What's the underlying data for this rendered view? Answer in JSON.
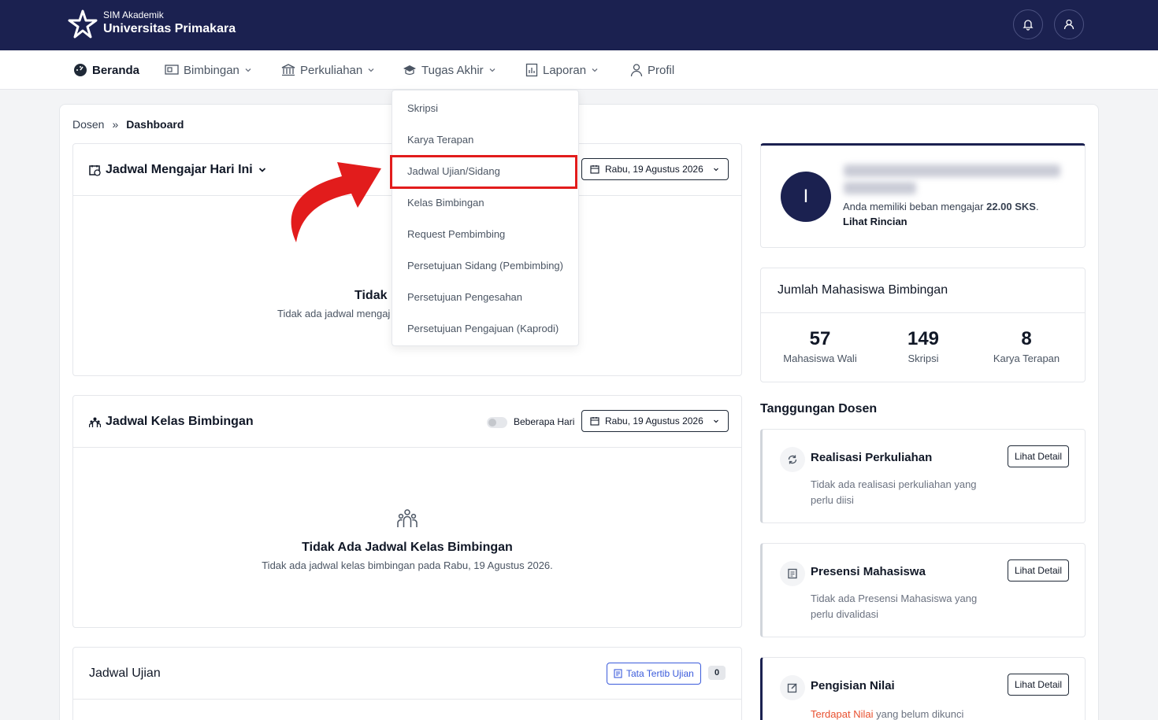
{
  "header": {
    "sub_title": "SIM Akademik",
    "title": "Universitas Primakara"
  },
  "nav": {
    "items": [
      {
        "label": "Beranda"
      },
      {
        "label": "Bimbingan"
      },
      {
        "label": "Perkuliahan"
      },
      {
        "label": "Tugas Akhir"
      },
      {
        "label": "Laporan"
      },
      {
        "label": "Profil"
      }
    ]
  },
  "tugas_akhir_menu": {
    "items": [
      {
        "label": "Skripsi"
      },
      {
        "label": "Karya Terapan"
      },
      {
        "label": "Jadwal Ujian/Sidang"
      },
      {
        "label": "Kelas Bimbingan"
      },
      {
        "label": "Request Pembimbing"
      },
      {
        "label": "Persetujuan Sidang (Pembimbing)"
      },
      {
        "label": "Persetujuan Pengesahan"
      },
      {
        "label": "Persetujuan Pengajuan (Kaprodi)"
      }
    ]
  },
  "breadcrumb": {
    "root": "Dosen",
    "separator": "»",
    "current": "Dashboard"
  },
  "jadwal_mengajar": {
    "title": "Jadwal Mengajar Hari Ini",
    "date": "Rabu, 19 Agustus 2026",
    "empty_title": "Tidak",
    "empty_text": "Tidak ada jadwal mengaj"
  },
  "jadwal_kelas": {
    "title": "Jadwal Kelas Bimbingan",
    "toggle_label": "Beberapa Hari",
    "date": "Rabu, 19 Agustus 2026",
    "empty_title": "Tidak Ada Jadwal Kelas Bimbingan",
    "empty_text": "Tidak ada jadwal kelas bimbingan pada Rabu, 19 Agustus 2026."
  },
  "jadwal_ujian": {
    "title": "Jadwal Ujian",
    "rules_button": "Tata Tertib Ujian",
    "count": "0"
  },
  "profile": {
    "initial": "I",
    "load_text": "Anda memiliki beban mengajar ",
    "load_value": "22.00 SKS",
    "load_suffix": ".",
    "detail_link": "Lihat Rincian"
  },
  "mahasiswa_bimbingan": {
    "title": "Jumlah Mahasiswa Bimbingan",
    "stats": [
      {
        "value": "57",
        "label": "Mahasiswa Wali"
      },
      {
        "value": "149",
        "label": "Skripsi"
      },
      {
        "value": "8",
        "label": "Karya Terapan"
      }
    ]
  },
  "tanggungan": {
    "title": "Tanggungan Dosen",
    "cards": [
      {
        "title": "Realisasi Perkuliahan",
        "text": "Tidak ada realisasi perkuliahan yang perlu diisi",
        "button": "Lihat Detail"
      },
      {
        "title": "Presensi Mahasiswa",
        "text": "Tidak ada Presensi Mahasiswa yang perlu divalidasi",
        "button": "Lihat Detail"
      },
      {
        "title": "Pengisian Nilai",
        "text_highlight": "Terdapat Nilai",
        "text": " yang belum dikunci",
        "button": "Lihat Detail"
      }
    ]
  },
  "colors": {
    "navy": "#1b2150",
    "highlight": "#e21c1c",
    "arrow": "#e21c1c",
    "link_blue": "#3b5bdb"
  }
}
